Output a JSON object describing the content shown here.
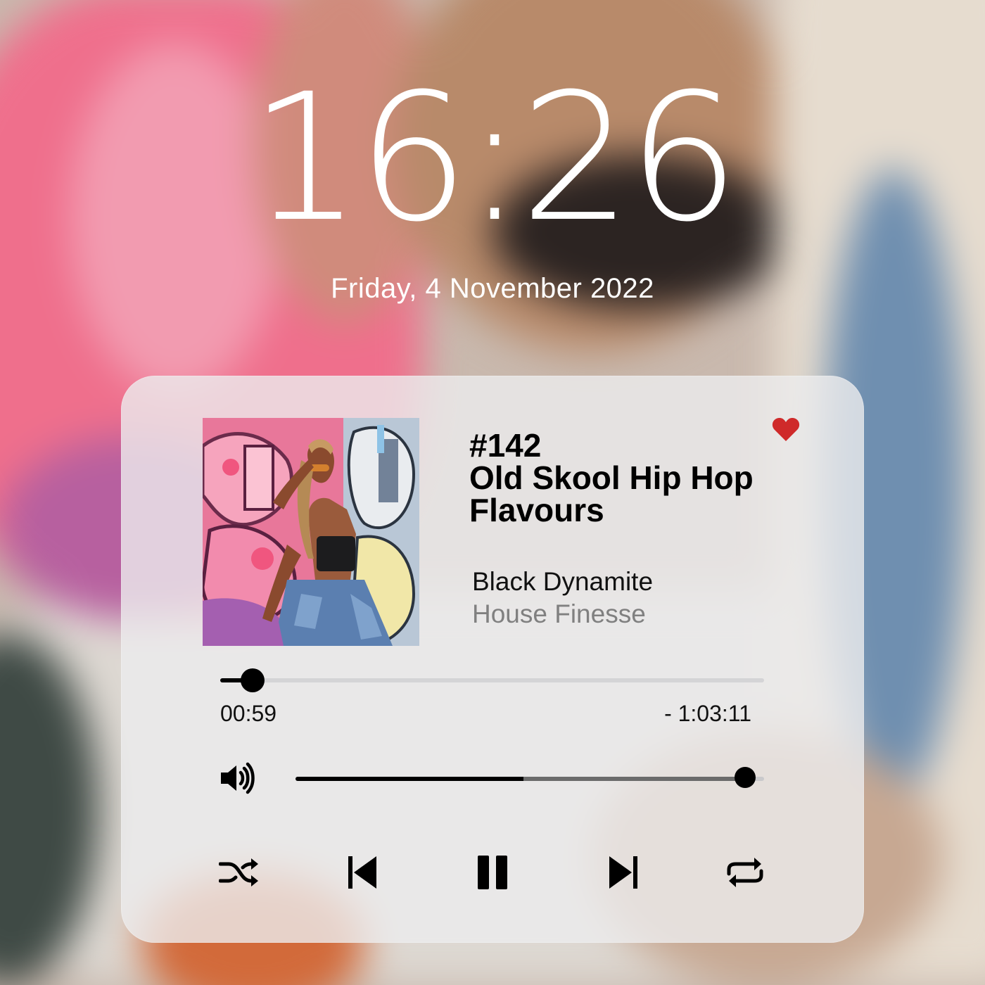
{
  "lockscreen": {
    "time": "16:26",
    "date": "Friday, 4 November 2022"
  },
  "player": {
    "episode_number": "#142",
    "title": "Old Skool Hip Hop Flavours",
    "artist": "Black Dynamite",
    "album": "House Finesse",
    "favorite": true,
    "artwork": "woman-in-front-of-pink-graffiti-wall",
    "elapsed": "00:59",
    "remaining": "- 1:03:11",
    "playback_progress": 0.06,
    "volume_level": 0.96,
    "icons": {
      "favorite": "heart-icon",
      "volume": "speaker-volume-icon",
      "shuffle": "shuffle-icon",
      "previous": "skip-previous-icon",
      "play_state": "pause-icon",
      "next": "skip-next-icon",
      "repeat": "repeat-icon"
    },
    "colors": {
      "heart": "#cf2a2a",
      "card_background": "#ececee",
      "album_text": "#808080"
    }
  }
}
